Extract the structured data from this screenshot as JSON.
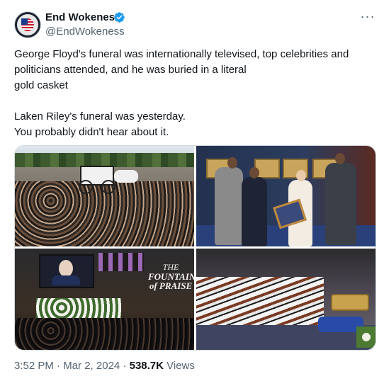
{
  "author": {
    "display_name": "End Wokeness",
    "handle": "@EndWokeness",
    "avatar_icon": "avatar-flag-emblem",
    "verified_icon": "verified-badge-icon",
    "verified_color": "#1d9bf0"
  },
  "more_icon": "more-horizontal-icon",
  "tweet": {
    "lines": [
      "George Floyd's funeral was internationally televised, top celebrities and",
      "politicians attended, and he was buried in a literal",
      "gold casket",
      "",
      "Laken Riley's funeral was yesterday.",
      "You probably didn't hear about it."
    ]
  },
  "media": {
    "photo_3_brand_line1": "THE",
    "photo_3_brand_line2": "FOUNTAIN",
    "photo_3_brand_line3": "of PRAISE"
  },
  "footer": {
    "time": "3:52 PM",
    "sep1": " · ",
    "date": "Mar 2, 2024",
    "sep2": " · ",
    "views_count": "538.7K",
    "views_label": " Views"
  },
  "colors": {
    "text": "#0f1419",
    "secondary": "#536471",
    "border": "#cfd9de"
  }
}
